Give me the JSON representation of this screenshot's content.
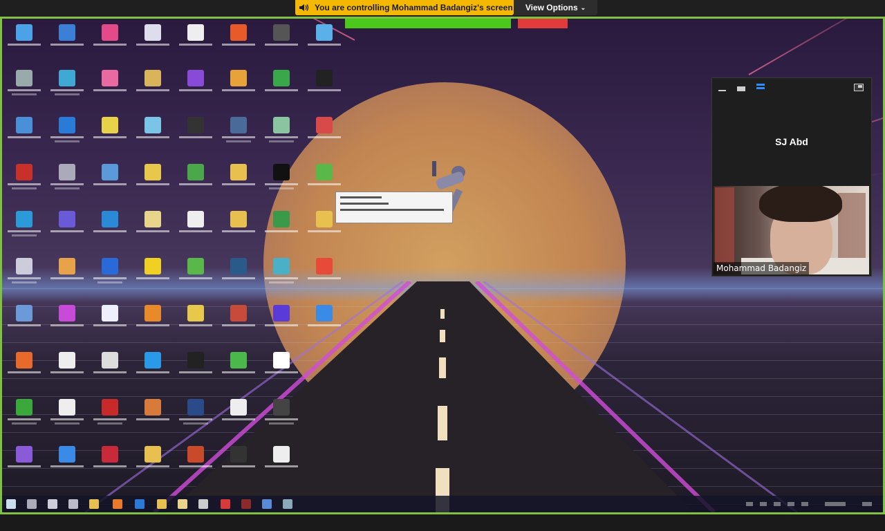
{
  "banner": {
    "control_text": "You are controlling Mohammad Badangiz's screen",
    "view_options_label": "View Options"
  },
  "panel": {
    "self_name": "SJ Abd",
    "participant_name": "Mohammad Badangiz"
  },
  "colors": {
    "banner_yellow": "#f5b800",
    "share_border_green": "#7fc241",
    "accent_blue": "#2d8cff"
  },
  "icons": [
    "speaker-icon",
    "chevron-down-icon",
    "minimize-icon",
    "gallery-icon",
    "speaker-view-icon",
    "pop-out-icon"
  ]
}
